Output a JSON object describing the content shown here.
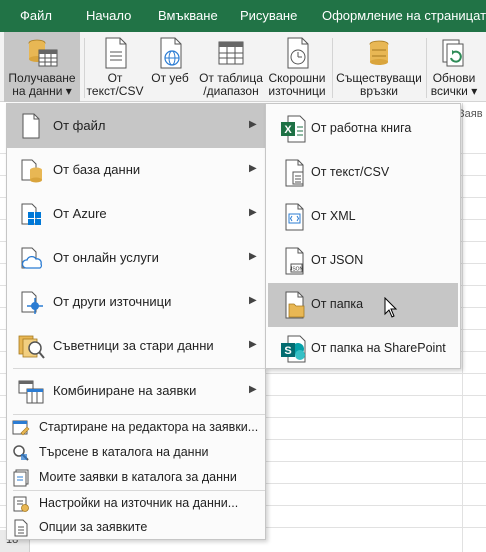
{
  "tabs": [
    "Файл",
    "Начало",
    "Вмъкване",
    "Рисуване",
    "Оформление на страницата"
  ],
  "ribbon": {
    "get_data": {
      "line1": "Получаване",
      "line2": "на данни ▾"
    },
    "from_text": {
      "line1": "От",
      "line2": "текст/CSV"
    },
    "from_web": {
      "line1": "От уеб",
      "line2": ""
    },
    "from_table": {
      "line1": "От таблица",
      "line2": "/диапазон"
    },
    "recent_sources": {
      "line1": "Скорошни",
      "line2": "източници"
    },
    "existing_connections": {
      "line1": "Съществуващи",
      "line2": "връзки"
    },
    "refresh_all": {
      "line1": "Обнови",
      "line2": "всички ▾"
    },
    "partial_group": "Заяв"
  },
  "menu": {
    "items": [
      {
        "label": "От файл",
        "icon": "file-icon"
      },
      {
        "label": "От база данни",
        "icon": "database-icon"
      },
      {
        "label": "От Azure",
        "icon": "windows-icon"
      },
      {
        "label": "От онлайн услуги",
        "icon": "cloud-icon"
      },
      {
        "label": "От други източници",
        "icon": "network-icon"
      },
      {
        "label": "Съветници за стари данни",
        "icon": "legacy-wizard-icon"
      },
      {
        "label": "Комбиниране на заявки",
        "icon": "combine-queries-icon"
      }
    ],
    "small_items": [
      {
        "label": "Стартиране на редактора на заявки...",
        "icon": "query-editor-icon"
      },
      {
        "label": "Търсене в каталога на данни",
        "icon": "search-catalog-icon"
      },
      {
        "label": "Моите заявки в каталога за данни",
        "icon": "my-queries-icon"
      },
      {
        "label": "Настройки на източник на данни...",
        "icon": "data-source-settings-icon"
      },
      {
        "label": "Опции за заявките",
        "icon": "query-options-icon"
      }
    ]
  },
  "submenu": {
    "items": [
      {
        "label": "От работна книга",
        "icon": "excel-workbook-icon"
      },
      {
        "label": "От текст/CSV",
        "icon": "text-file-icon"
      },
      {
        "label": "От XML",
        "icon": "xml-file-icon"
      },
      {
        "label": "От JSON",
        "icon": "json-file-icon"
      },
      {
        "label": "От папка",
        "icon": "folder-icon"
      },
      {
        "label": "От папка на SharePoint",
        "icon": "sharepoint-icon"
      }
    ]
  },
  "sheet": {
    "row_number": "18"
  },
  "colors": {
    "accent": "#217346",
    "selected": "#c6c6c6",
    "ribbon_bg": "#f3f3f3",
    "excel_green": "#1e7145",
    "sharepoint_blue": "#036c70",
    "folder": "#e8b754",
    "azure_blue": "#0078d7"
  }
}
